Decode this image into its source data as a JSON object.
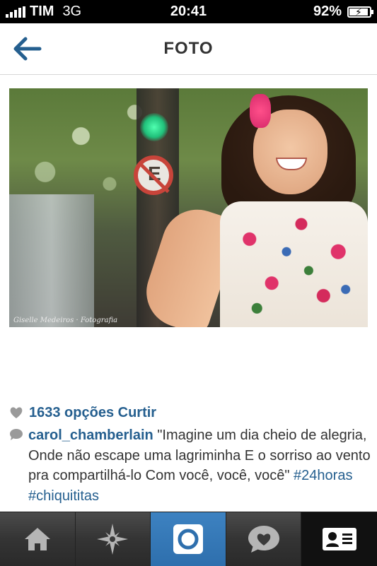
{
  "status_bar": {
    "carrier": "TIM",
    "network": "3G",
    "time": "20:41",
    "battery": "92%",
    "battery_level": 0.92,
    "signal_bars": 5
  },
  "nav": {
    "title": "FOTO",
    "back_icon": "arrow-left-icon"
  },
  "post": {
    "photo_watermark": "Giselle Medeiros · Fotografia",
    "likes": "1633 opções Curtir",
    "caption": {
      "username": "carol_chamberlain",
      "text": "\"Imagine um dia cheio de alegria, Onde não escape uma lagriminha E o sorriso ao vento pra compartilhá-lo Com você, você, você\"",
      "hashtag1": "#24horas",
      "hashtag2": "#chiquititas"
    }
  },
  "tab_bar": {
    "items": [
      {
        "icon": "home-icon"
      },
      {
        "icon": "explore-icon"
      },
      {
        "icon": "camera-icon",
        "active": true
      },
      {
        "icon": "activity-icon"
      },
      {
        "icon": "profile-icon"
      }
    ]
  },
  "colors": {
    "accent": "#255f8f",
    "tab_active": "#3d82c1"
  }
}
